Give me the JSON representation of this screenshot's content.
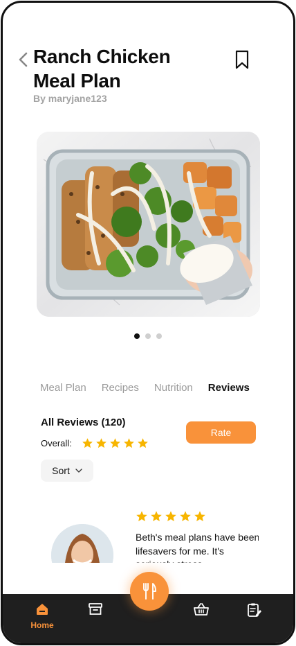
{
  "header": {
    "title": "Ranch Chicken Meal Plan",
    "author": "By maryjane123",
    "back_icon": "chevron-left-icon",
    "bookmark_icon": "bookmark-icon"
  },
  "carousel": {
    "total_slides": 3,
    "active_slide": 1
  },
  "tabs": [
    {
      "label": "Meal Plan",
      "active": false
    },
    {
      "label": "Recipes",
      "active": false
    },
    {
      "label": "Nutrition",
      "active": false
    },
    {
      "label": "Reviews",
      "active": true
    }
  ],
  "reviews": {
    "heading": "All Reviews (120)",
    "overall_label": "Overall:",
    "overall_rating": 5,
    "rate_label": "Rate",
    "sort_label": "Sort",
    "items": [
      {
        "rating": 5,
        "text": "Beth's meal plans have been lifesavers for me. It's seriously stress"
      }
    ]
  },
  "nav": {
    "items": [
      {
        "label": "Home",
        "icon": "home-icon",
        "active": true
      },
      {
        "label": "",
        "icon": "archive-icon",
        "active": false
      },
      {
        "label": "",
        "icon": "fork-knife-icon",
        "active": false
      },
      {
        "label": "",
        "icon": "basket-icon",
        "active": false
      },
      {
        "label": "",
        "icon": "clipboard-edit-icon",
        "active": false
      }
    ]
  },
  "colors": {
    "accent": "#f9923a",
    "star": "#f7b500",
    "nav_bg": "#1f1f1f",
    "muted": "#9a9a9a"
  }
}
